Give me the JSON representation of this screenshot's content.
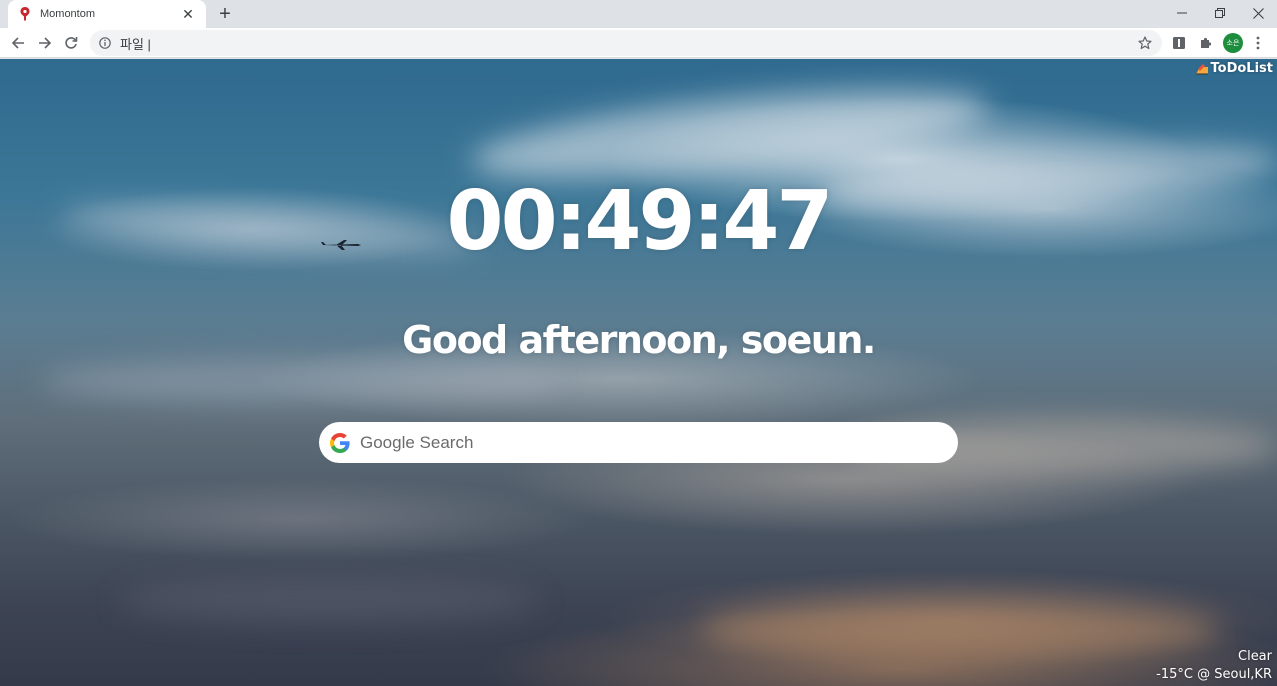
{
  "browser": {
    "tab": {
      "title": "Momontom",
      "favicon": "pin-icon"
    },
    "omnibox": {
      "text": "파일 |"
    },
    "profile_initials": "소은"
  },
  "page": {
    "todo_link": "ToDoList",
    "clock": "00:49:47",
    "greeting": "Good afternoon, soeun.",
    "search": {
      "placeholder": "Google Search",
      "value": ""
    },
    "weather": {
      "condition": "Clear",
      "temp_location": "-15°C @ Seoul,KR"
    }
  },
  "colors": {
    "chrome_bg": "#dee1e6",
    "sky_top": "#2f6a8f",
    "sky_bottom": "#343a4a",
    "profile_green": "#1e8e3e"
  }
}
